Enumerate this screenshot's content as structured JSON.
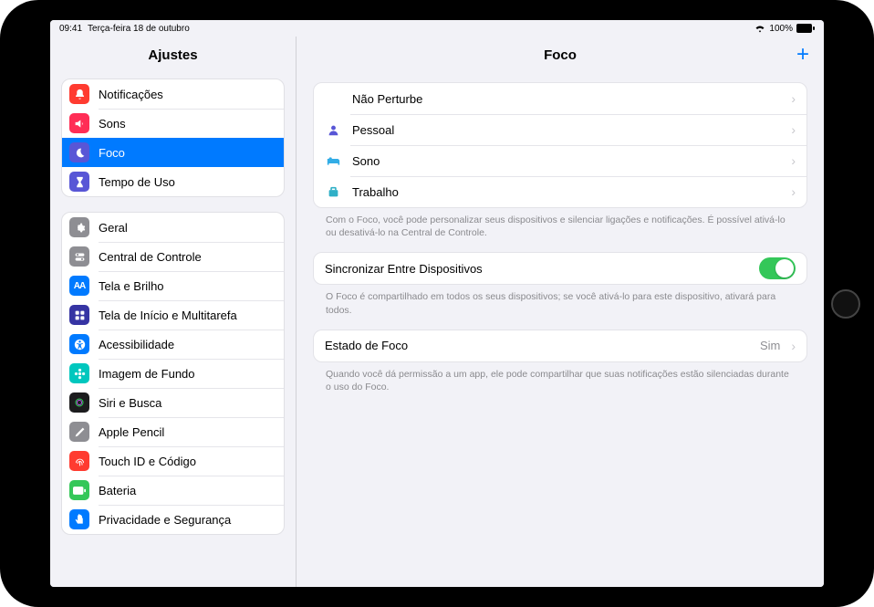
{
  "status": {
    "time": "09:41",
    "date": "Terça-feira 18 de outubro",
    "battery": "100%"
  },
  "sidebar": {
    "title": "Ajustes",
    "groups": [
      {
        "items": [
          {
            "label": "Notificações",
            "icon": "bell",
            "color": "#ff3b30"
          },
          {
            "label": "Sons",
            "icon": "speaker",
            "color": "#ff2d55"
          },
          {
            "label": "Foco",
            "icon": "moon",
            "color": "#5856d6",
            "selected": true
          },
          {
            "label": "Tempo de Uso",
            "icon": "hourglass",
            "color": "#5856d6"
          }
        ]
      },
      {
        "items": [
          {
            "label": "Geral",
            "icon": "gear",
            "color": "#8e8e93"
          },
          {
            "label": "Central de Controle",
            "icon": "switches",
            "color": "#8e8e93"
          },
          {
            "label": "Tela e Brilho",
            "icon": "AA",
            "color": "#007aff"
          },
          {
            "label": "Tela de Início e Multitarefa",
            "icon": "grid",
            "color": "#3634a3"
          },
          {
            "label": "Acessibilidade",
            "icon": "accessibility",
            "color": "#007aff"
          },
          {
            "label": "Imagem de Fundo",
            "icon": "flower",
            "color": "#00c7be"
          },
          {
            "label": "Siri e Busca",
            "icon": "siri",
            "color": "#1c1c1e"
          },
          {
            "label": "Apple Pencil",
            "icon": "pencil",
            "color": "#8e8e93"
          },
          {
            "label": "Touch ID e Código",
            "icon": "touchid",
            "color": "#ff3b30"
          },
          {
            "label": "Bateria",
            "icon": "battery",
            "color": "#34c759"
          },
          {
            "label": "Privacidade e Segurança",
            "icon": "hand",
            "color": "#007aff"
          }
        ]
      }
    ]
  },
  "detail": {
    "title": "Foco",
    "focus_modes": [
      {
        "label": "Não Perturbe",
        "icon": "moon",
        "color": "#5856d6"
      },
      {
        "label": "Pessoal",
        "icon": "person",
        "color": "#5856d6"
      },
      {
        "label": "Sono",
        "icon": "bed",
        "color": "#32ade6"
      },
      {
        "label": "Trabalho",
        "icon": "briefcase",
        "color": "#30b0c7"
      }
    ],
    "focus_footer": "Com o Foco, você pode personalizar seus dispositivos e silenciar ligações e notificações. É possível ativá-lo ou desativá-lo na Central de Controle.",
    "sync": {
      "label": "Sincronizar Entre Dispositivos",
      "on": true,
      "footer": "O Foco é compartilhado em todos os seus dispositivos; se você ativá-lo para este dispositivo, ativará para todos."
    },
    "status": {
      "label": "Estado de Foco",
      "value": "Sim",
      "footer": "Quando você dá permissão a um app, ele pode compartilhar que suas notificações estão silenciadas durante o uso do Foco."
    }
  }
}
